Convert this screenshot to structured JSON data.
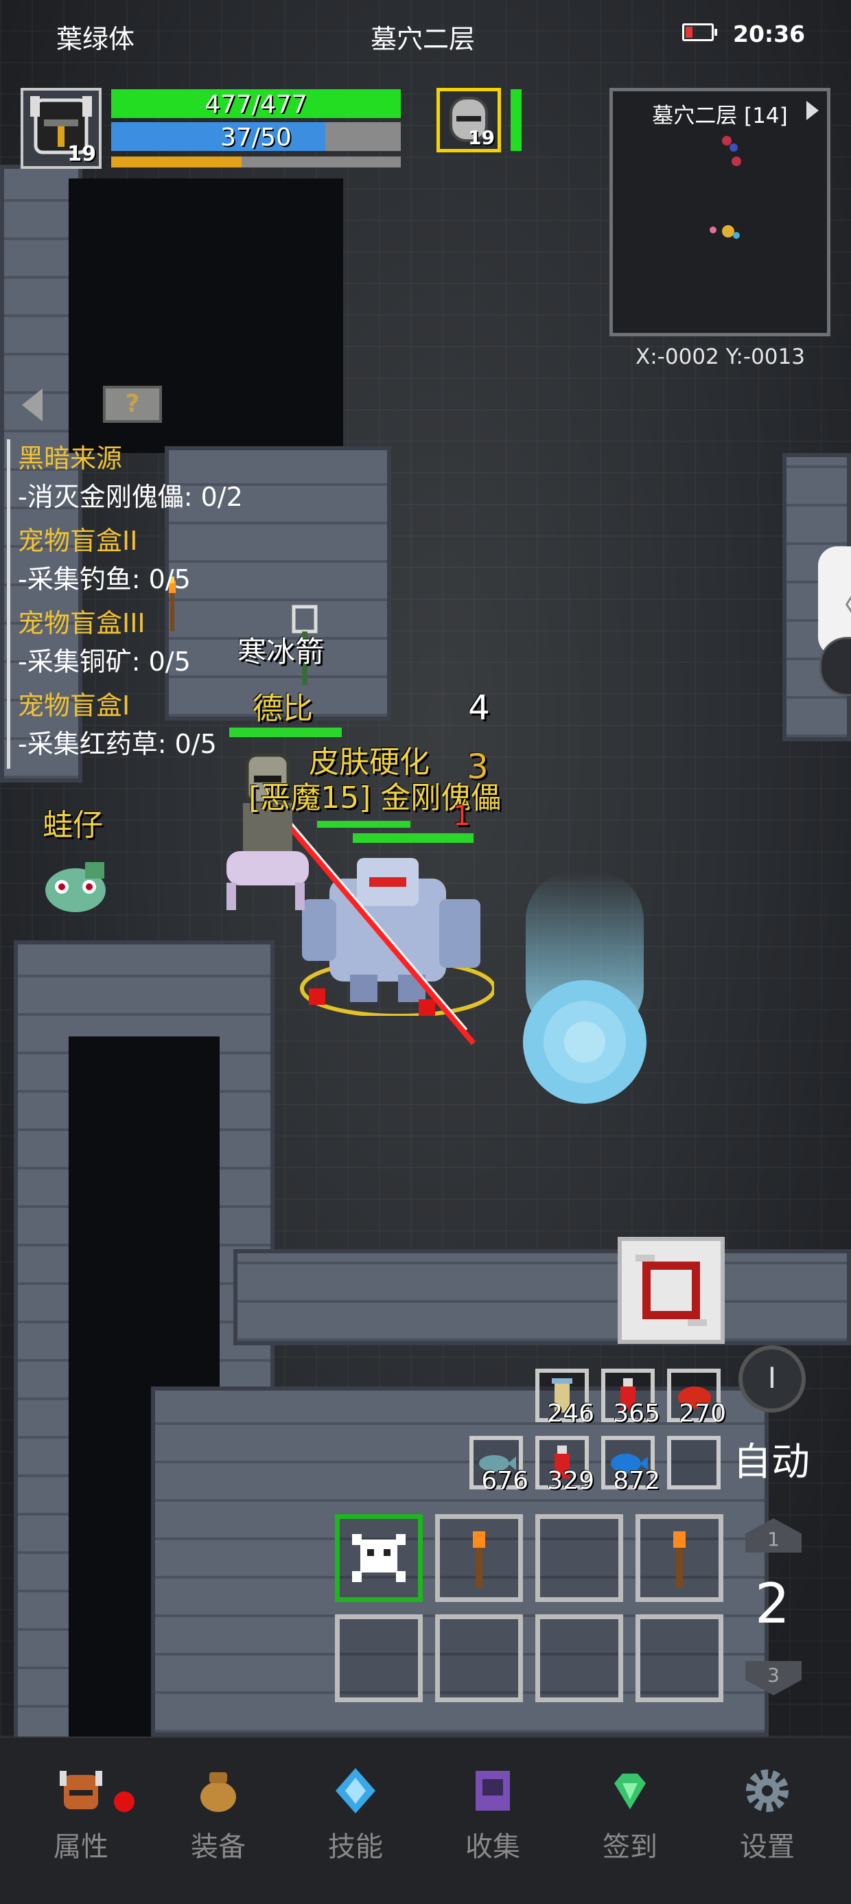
{
  "status_bar": {
    "left_text": "葉绿体",
    "center_text": "墓穴二层",
    "time": "20:36"
  },
  "player": {
    "level": "19",
    "hp_text": "477/477",
    "hp_fraction": 1.0,
    "mp_text": "37/50",
    "mp_fraction": 0.74,
    "exp_fraction": 0.45
  },
  "pet": {
    "level": "19",
    "hp_fraction": 1.0
  },
  "minimap": {
    "title": "墓穴二层 [14]",
    "coords": "X:-0002  Y:-0013"
  },
  "quests": [
    {
      "title": "黑暗来源",
      "task": "-消灭金刚傀儡: 0/2"
    },
    {
      "title": "宠物盲盒II",
      "task": "-采集钓鱼: 0/5"
    },
    {
      "title": "宠物盲盒III",
      "task": "-采集铜矿: 0/5"
    },
    {
      "title": "宠物盲盒I",
      "task": "-采集红药草: 0/5"
    }
  ],
  "help_label": "?",
  "scene": {
    "spell_name": "寒冰箭",
    "ally_name": "德比",
    "pet_name": "蛙仔",
    "buff_text": "皮肤硬化",
    "enemy_name": "[恶魔15] 金刚傀儡",
    "damage_1": "4",
    "damage_2": "3",
    "damage_3": "1"
  },
  "consumables": [
    {
      "icon": "scroll-icon",
      "count": "246"
    },
    {
      "icon": "red-potion-icon",
      "count": "365"
    },
    {
      "icon": "raw-meat-icon",
      "count": "270"
    },
    {
      "icon": "fish-icon",
      "count": "676"
    },
    {
      "icon": "red-potion-icon",
      "count": "329"
    },
    {
      "icon": "blue-fish-icon",
      "count": "872"
    },
    {
      "icon": "empty-slot",
      "count": ""
    }
  ],
  "controls": {
    "cycle_symbol": "I",
    "auto_label": "自动",
    "layer_up": "1",
    "layer_current": "2",
    "layer_down": "3"
  },
  "nav": [
    {
      "label": "属性",
      "icon": "helmet-icon",
      "color": "#c0622a"
    },
    {
      "label": "装备",
      "icon": "bag-icon",
      "color": "#c08a3a"
    },
    {
      "label": "技能",
      "icon": "crystal-icon",
      "color": "#3aa8e6"
    },
    {
      "label": "收集",
      "icon": "book-icon",
      "color": "#7a4fb5"
    },
    {
      "label": "签到",
      "icon": "gem-icon",
      "color": "#38c46a"
    },
    {
      "label": "设置",
      "icon": "gear-icon",
      "color": "#7a8a96"
    }
  ]
}
